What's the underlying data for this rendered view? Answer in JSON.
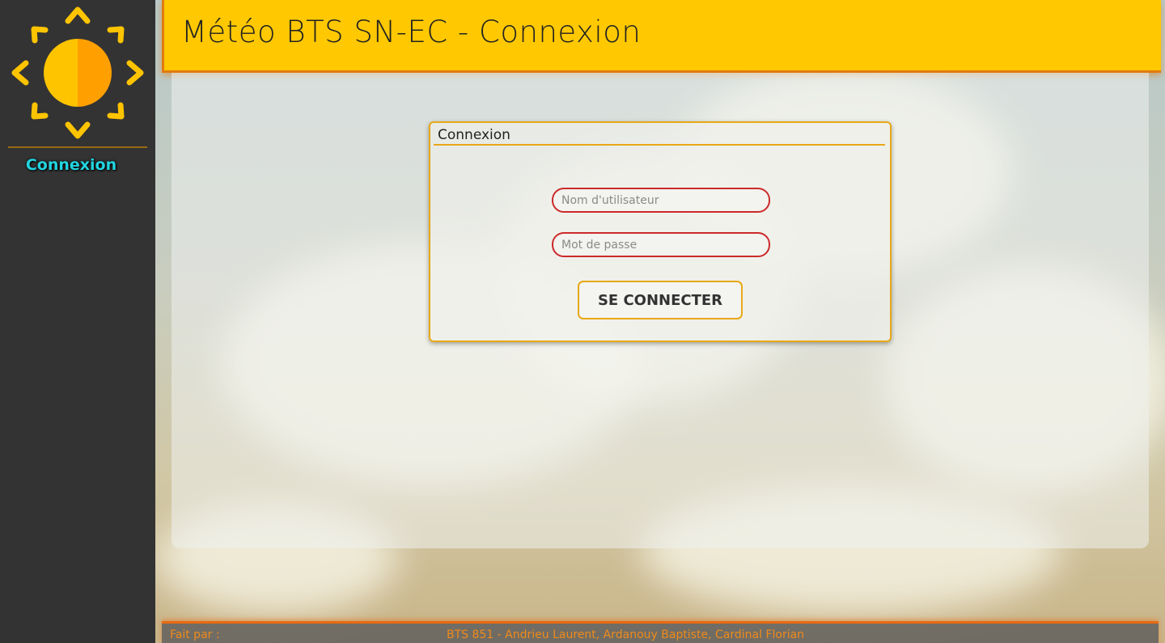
{
  "header": {
    "title": "Météo BTS SN-EC - Connexion"
  },
  "sidebar": {
    "logo_icon": "sun-icon",
    "items": [
      {
        "label": "Connexion"
      }
    ]
  },
  "login": {
    "legend": "Connexion",
    "username_placeholder": "Nom d'utilisateur",
    "password_placeholder": "Mot de passe",
    "submit_label": "SE CONNECTER"
  },
  "footer": {
    "label": "Fait par :",
    "credits": "BTS 851 - Andrieu Laurent, Ardanouy Baptiste, Cardinal Florian"
  },
  "colors": {
    "header_bg": "#ffc800",
    "accent_orange": "#e07b10",
    "sidebar_bg": "#333333",
    "link_cyan": "#22d4e0",
    "input_border": "#cc2a2a",
    "card_border": "#e8a818"
  }
}
